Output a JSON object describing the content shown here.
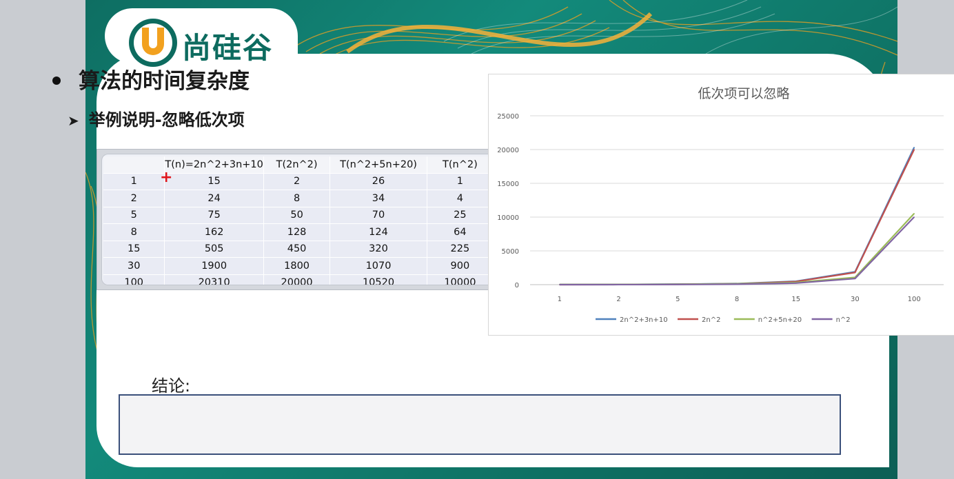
{
  "brand": {
    "name": "尚硅谷",
    "letter": "U"
  },
  "slide": {
    "bullet": "算法的时间复杂度",
    "subheading": "举例说明-忽略低次项",
    "conclusion_label": "结论:"
  },
  "table": {
    "headers": [
      "",
      "T(n)=2n^2+3n+10",
      "T(2n^2)",
      "T(n^2+5n+20)",
      "T(n^2)"
    ],
    "rows": [
      [
        "1",
        "15",
        "2",
        "26",
        "1"
      ],
      [
        "2",
        "24",
        "8",
        "34",
        "4"
      ],
      [
        "5",
        "75",
        "50",
        "70",
        "25"
      ],
      [
        "8",
        "162",
        "128",
        "124",
        "64"
      ],
      [
        "15",
        "505",
        "450",
        "320",
        "225"
      ],
      [
        "30",
        "1900",
        "1800",
        "1070",
        "900"
      ],
      [
        "100",
        "20310",
        "20000",
        "10520",
        "10000"
      ]
    ]
  },
  "chart_data": {
    "type": "line",
    "title": "低次项可以忽略",
    "categories": [
      "1",
      "2",
      "5",
      "8",
      "15",
      "30",
      "100"
    ],
    "series": [
      {
        "name": "2n^2+3n+10",
        "color": "#4f81bd",
        "values": [
          15,
          24,
          75,
          162,
          505,
          1900,
          20310
        ]
      },
      {
        "name": "2n^2",
        "color": "#c0504d",
        "values": [
          2,
          8,
          50,
          128,
          450,
          1800,
          20000
        ]
      },
      {
        "name": "n^2+5n+20",
        "color": "#9bbb59",
        "values": [
          26,
          34,
          70,
          124,
          320,
          1070,
          10520
        ]
      },
      {
        "name": "n^2",
        "color": "#8064a2",
        "values": [
          1,
          4,
          25,
          64,
          225,
          900,
          10000
        ]
      }
    ],
    "yticks": [
      0,
      5000,
      10000,
      15000,
      20000,
      25000
    ],
    "ylim": [
      0,
      25000
    ],
    "grid": true,
    "legend": "bottom"
  },
  "colors": {
    "teal": "#0f7567",
    "orange": "#f2a11f",
    "box_border": "#3a4f7a"
  }
}
